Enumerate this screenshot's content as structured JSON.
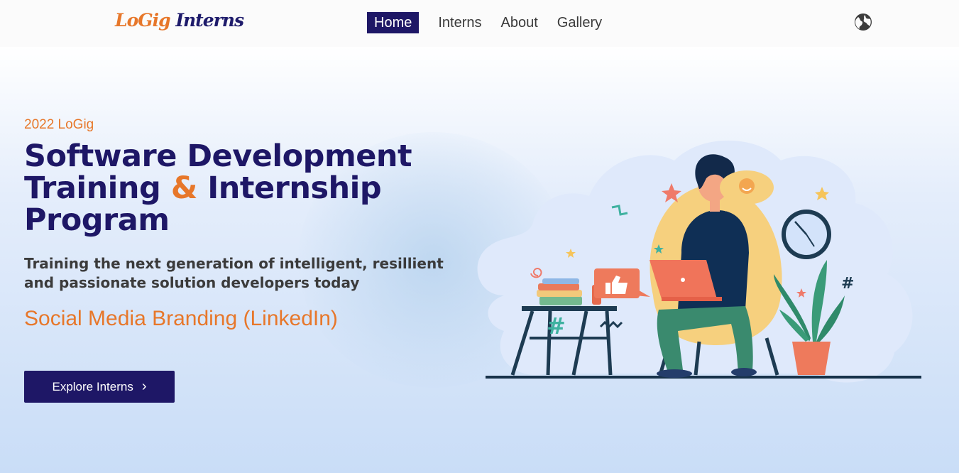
{
  "header": {
    "logo_part1": "LoGig",
    "logo_part2": "Interns",
    "nav": [
      {
        "label": "Home",
        "active": true
      },
      {
        "label": "Interns",
        "active": false
      },
      {
        "label": "About",
        "active": false
      },
      {
        "label": "Gallery",
        "active": false
      }
    ],
    "language_icon": "globe-icon"
  },
  "hero": {
    "eyebrow": "2022 LoGig",
    "headline_line1": "Software Development",
    "headline_line2_a": "Training",
    "headline_amp": "&",
    "headline_line2_b": "Internship",
    "headline_line3": "Program",
    "subheading": "Training the next generation of intelligent, resillient and passionate solution developers today",
    "topic": "Social Media Branding (LinkedIn)",
    "cta_label": "Explore Interns",
    "cta_icon": "chevron-right-icon"
  },
  "colors": {
    "brand_navy": "#1e1766",
    "brand_orange": "#e7772a",
    "hero_gradient_end": "#c9ddf7"
  }
}
